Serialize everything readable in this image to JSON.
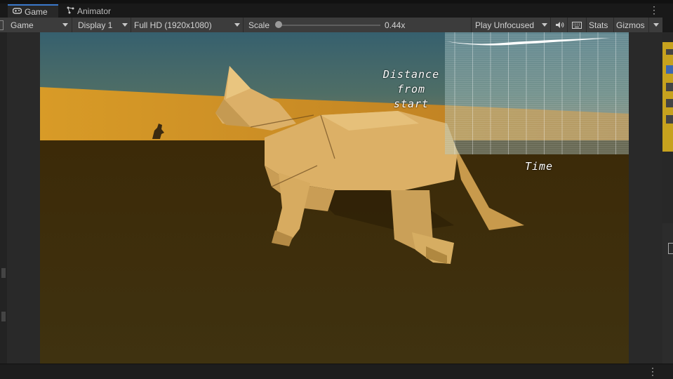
{
  "tabs": [
    {
      "label": "Game",
      "icon": "gamepad-icon",
      "active": true
    },
    {
      "label": "Animator",
      "icon": "animator-icon",
      "active": false
    }
  ],
  "toolbar": {
    "view_mode": "Game",
    "display": "Display 1",
    "resolution": "Full HD (1920x1080)",
    "scale_label": "Scale",
    "scale_value": "0.44x",
    "play_mode": "Play Unfocused",
    "stats": "Stats",
    "gizmos": "Gizmos"
  },
  "overlay": {
    "y_label": [
      "Distance",
      "from",
      "start"
    ],
    "x_label": "Time"
  },
  "colors": {
    "accent": "#3a78c9",
    "toolbar_bg": "#3c3c3c",
    "sky_top": "#3a6777",
    "dunes": "#d29a2e",
    "ground": "#3f3110",
    "cat": "#dab065"
  }
}
